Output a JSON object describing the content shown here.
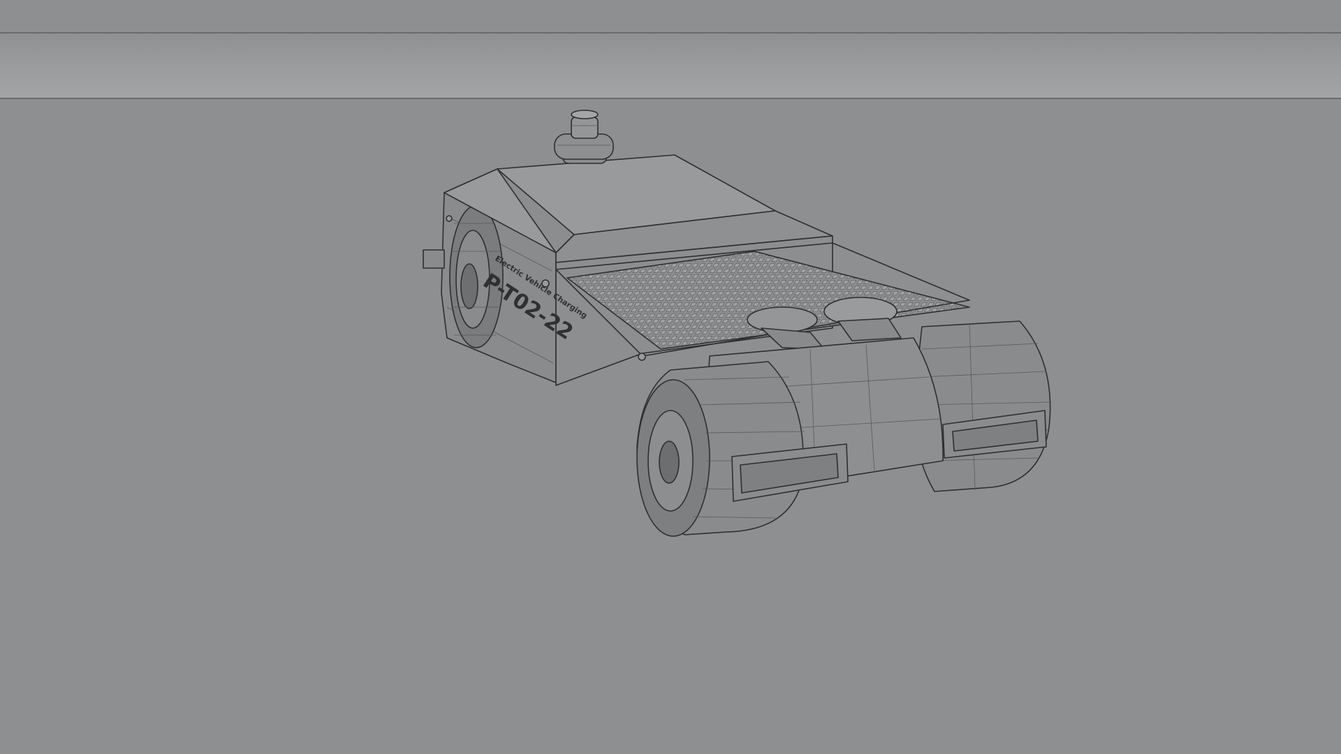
{
  "viewport": {
    "background_color": "#8e8f91",
    "horizon_band_color": "#a3a4a6",
    "line_color": "#6a6b6d"
  },
  "model": {
    "side_text_small": "Electric Vehicle Charging",
    "side_text_id": "P-T02-22",
    "shell_color": "#929395",
    "edge_color": "#2d2e30"
  }
}
